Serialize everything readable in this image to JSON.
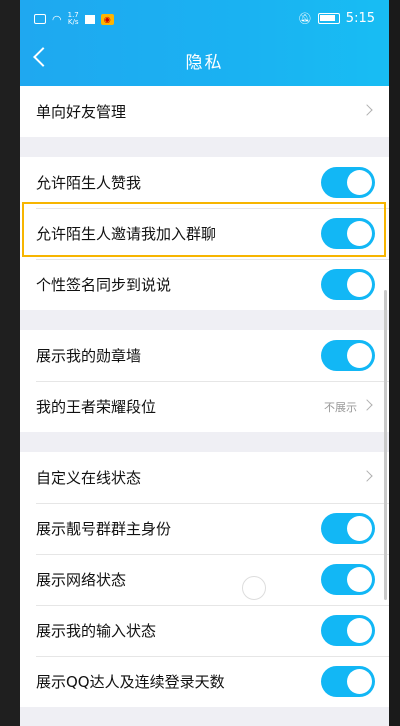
{
  "status_bar": {
    "speed": "1.7\nK/s",
    "time": "5:15"
  },
  "nav": {
    "title": "隐私"
  },
  "groups": [
    {
      "rows": [
        {
          "label": "单向好友管理",
          "control": "chevron"
        }
      ]
    },
    {
      "rows": [
        {
          "label": "允许陌生人赞我",
          "control": "toggle",
          "on": true
        },
        {
          "label": "允许陌生人邀请我加入群聊",
          "control": "toggle",
          "on": true,
          "highlighted": true
        },
        {
          "label": "个性签名同步到说说",
          "control": "toggle",
          "on": true
        }
      ]
    },
    {
      "rows": [
        {
          "label": "展示我的勋章墙",
          "control": "toggle",
          "on": true
        },
        {
          "label": "我的王者荣耀段位",
          "control": "value-chevron",
          "value": "不展示"
        }
      ]
    },
    {
      "rows": [
        {
          "label": "自定义在线状态",
          "control": "chevron"
        },
        {
          "label": "展示靓号群群主身份",
          "control": "toggle",
          "on": true
        },
        {
          "label": "展示网络状态",
          "control": "toggle",
          "on": true
        },
        {
          "label": "展示我的输入状态",
          "control": "toggle",
          "on": true
        },
        {
          "label": "展示QQ达人及连续登录天数",
          "control": "toggle",
          "on": true
        }
      ]
    }
  ],
  "colors": {
    "header": "#1fa8f0",
    "toggle_on": "#12b7f5",
    "highlight": "#f7b500"
  }
}
